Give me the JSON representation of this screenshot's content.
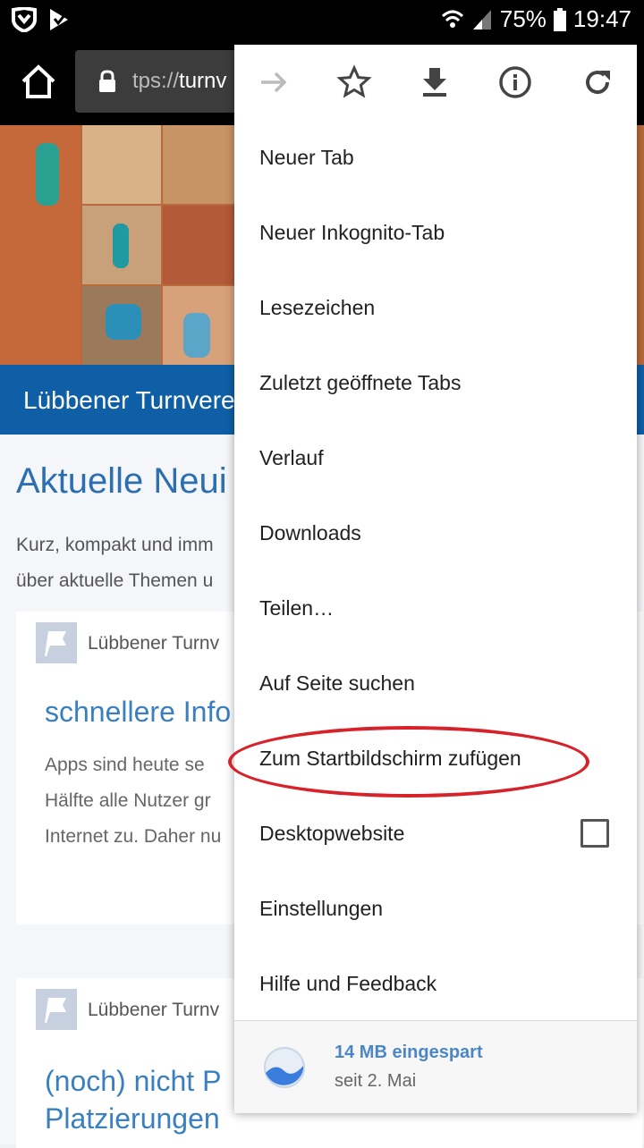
{
  "status_bar": {
    "battery": "75%",
    "time": "19:47",
    "icons": [
      "shield-icon",
      "check-flag-icon",
      "wifi-icon",
      "signal-icon",
      "battery-icon"
    ]
  },
  "toolbar": {
    "url_prefix": "tps://",
    "url_host": "turnv"
  },
  "page": {
    "band_title": "Lübbener Turnvere",
    "heading": "Aktuelle Neui",
    "intro_line1": "Kurz, kompakt und imm",
    "intro_line2": "über aktuelle Themen u",
    "card1": {
      "org": "Lübbener Turnv",
      "title": "schnellere Info",
      "line1": "Apps sind heute se",
      "line2": "Hälfte alle Nutzer gr",
      "line3": "Internet zu. Daher nu"
    },
    "card2": {
      "org": "Lübbener Turnv",
      "title1": "(noch) nicht P",
      "title2": "Platzierungen"
    }
  },
  "menu": {
    "top_icons": [
      "forward-icon",
      "star-icon",
      "download-icon",
      "info-icon",
      "refresh-icon"
    ],
    "items": [
      "Neuer Tab",
      "Neuer Inkognito-Tab",
      "Lesezeichen",
      "Zuletzt geöffnete Tabs",
      "Verlauf",
      "Downloads",
      "Teilen…",
      "Auf Seite suchen",
      "Zum Startbildschirm zufügen",
      "Desktopwebsite",
      "Einstellungen",
      "Hilfe und Feedback"
    ],
    "desktop_site_checked": false,
    "footer": {
      "saved": "14 MB eingespart",
      "since": "seit 2. Mai"
    }
  },
  "colors": {
    "annotation": "#d8222a",
    "brand_blue": "#0f5fa6",
    "link_blue": "#4a86c8"
  }
}
